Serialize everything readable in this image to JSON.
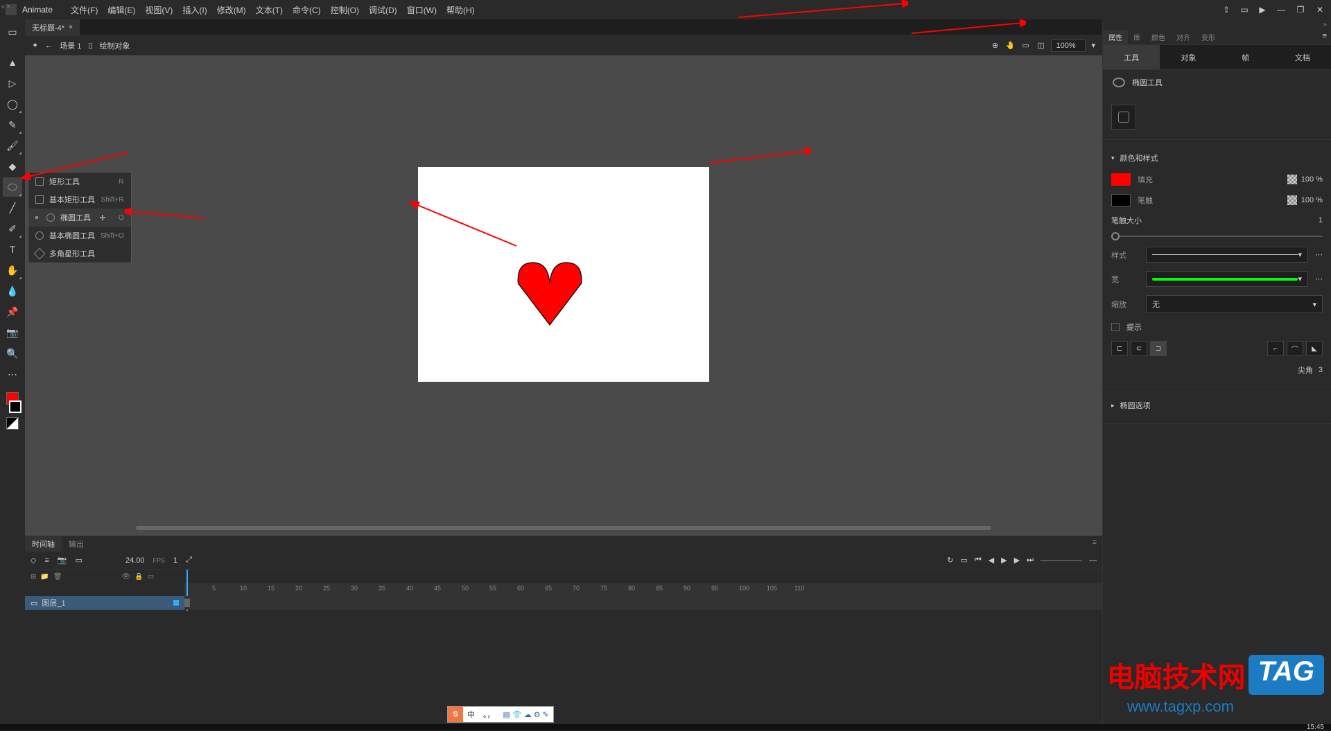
{
  "app_name": "Animate",
  "menu": [
    "文件(F)",
    "编辑(E)",
    "视图(V)",
    "插入(I)",
    "修改(M)",
    "文本(T)",
    "命令(C)",
    "控制(O)",
    "调试(D)",
    "窗口(W)",
    "帮助(H)"
  ],
  "doc_tab": {
    "title": "无标题-4*",
    "close": "×"
  },
  "scene": {
    "icon": "✦",
    "back": "←",
    "label": "场景 1",
    "frame": "▯",
    "mode": "绘制对象",
    "zoom": "100%"
  },
  "tool_flyout": [
    {
      "label": "矩形工具",
      "shortcut": "R",
      "icon": "rect"
    },
    {
      "label": "基本矩形工具",
      "shortcut": "Shift+R",
      "icon": "rect"
    },
    {
      "label": "椭圆工具",
      "shortcut": "O",
      "icon": "oval",
      "selected": true
    },
    {
      "label": "基本椭圆工具",
      "shortcut": "Shift+O",
      "icon": "oval"
    },
    {
      "label": "多角星形工具",
      "shortcut": "",
      "icon": "poly"
    }
  ],
  "timeline": {
    "tab1": "时间轴",
    "tab2": "输出",
    "fps": "24.00",
    "fps_label": "FPS",
    "frame_num": "1",
    "layer_name": "图层_1",
    "ruler": [
      5,
      10,
      15,
      20,
      25,
      30,
      35,
      40,
      45,
      50,
      55,
      60,
      65,
      70,
      75,
      80,
      85,
      90,
      95,
      100,
      105,
      110
    ]
  },
  "panel": {
    "tabs": [
      "属性",
      "库",
      "颜色",
      "对齐",
      "变形"
    ],
    "subtabs": [
      "工具",
      "对象",
      "帧",
      "文档"
    ],
    "tool_name": "椭圆工具",
    "section_color": "颜色和样式",
    "fill_label": "填充",
    "fill_pct": "100 %",
    "stroke_label": "笔触",
    "stroke_pct": "100 %",
    "stroke_size_label": "笔触大小",
    "stroke_size_val": "1",
    "style_label": "样式",
    "width_label": "宽",
    "scale_label": "缩放",
    "scale_val": "无",
    "hint_label": "提示",
    "corner_label": "尖角",
    "corner_val": "3",
    "section_oval": "椭圆选项"
  },
  "ime": {
    "lang": "中",
    "punct": "。，",
    "icons": "▤ 👕 ☁ ⚙ ✎"
  },
  "watermark": {
    "cn": "电脑技术网",
    "tag": "TAG",
    "url": "www.tagxp.com"
  },
  "taskbar_time": "15:45"
}
